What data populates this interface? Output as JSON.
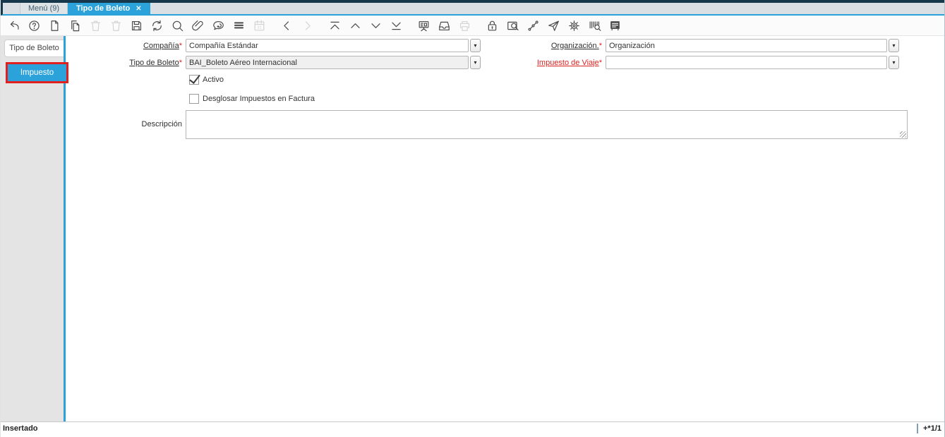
{
  "window": {
    "tabs": [
      {
        "label": "Menú (9)",
        "active": false
      },
      {
        "label": "Tipo de Boleto",
        "active": true,
        "close_glyph": "✕"
      }
    ]
  },
  "toolbar": {
    "items": [
      {
        "name": "undo",
        "icon": "undo",
        "disabled": false,
        "gap": false
      },
      {
        "name": "help",
        "icon": "help",
        "disabled": false,
        "gap": false
      },
      {
        "name": "new-record",
        "icon": "new",
        "disabled": false,
        "gap": false
      },
      {
        "name": "copy-record",
        "icon": "copy",
        "disabled": false,
        "gap": false
      },
      {
        "name": "delete-record",
        "icon": "trash",
        "disabled": true,
        "gap": false
      },
      {
        "name": "delete-selection",
        "icon": "trash",
        "disabled": true,
        "gap": false
      },
      {
        "name": "save-record",
        "icon": "save",
        "disabled": false,
        "gap": false
      },
      {
        "name": "requery",
        "icon": "refresh",
        "disabled": false,
        "gap": false
      },
      {
        "name": "find-record",
        "icon": "find",
        "disabled": false,
        "gap": false
      },
      {
        "name": "attachment",
        "icon": "attach",
        "disabled": false,
        "gap": false
      },
      {
        "name": "chat",
        "icon": "chat",
        "disabled": false,
        "gap": false
      },
      {
        "name": "grid-toggle",
        "icon": "lines",
        "disabled": false,
        "gap": false
      },
      {
        "name": "history",
        "icon": "calendar",
        "disabled": true,
        "gap": false
      },
      {
        "name": "parent-record",
        "icon": "chevL",
        "disabled": false,
        "gap": true
      },
      {
        "name": "detail-record",
        "icon": "chevR",
        "disabled": true,
        "gap": false
      },
      {
        "name": "first-record",
        "icon": "first",
        "disabled": false,
        "gap": true
      },
      {
        "name": "previous-record",
        "icon": "prev",
        "disabled": false,
        "gap": false
      },
      {
        "name": "next-record",
        "icon": "next",
        "disabled": false,
        "gap": false
      },
      {
        "name": "last-record",
        "icon": "last",
        "disabled": false,
        "gap": false
      },
      {
        "name": "report",
        "icon": "report",
        "disabled": false,
        "gap": true
      },
      {
        "name": "archive",
        "icon": "archive",
        "disabled": false,
        "gap": false
      },
      {
        "name": "print",
        "icon": "print",
        "disabled": true,
        "gap": false
      },
      {
        "name": "lock-record",
        "icon": "lock",
        "disabled": false,
        "gap": true
      },
      {
        "name": "zoom-across",
        "icon": "zoomx",
        "disabled": false,
        "gap": false
      },
      {
        "name": "workflow",
        "icon": "wf",
        "disabled": false,
        "gap": false
      },
      {
        "name": "run-process",
        "icon": "plane",
        "disabled": false,
        "gap": false
      },
      {
        "name": "preferences",
        "icon": "gear",
        "disabled": false,
        "gap": false
      },
      {
        "name": "product-info",
        "icon": "barcode",
        "disabled": false,
        "gap": false
      },
      {
        "name": "window-help",
        "icon": "notice",
        "disabled": false,
        "gap": false
      }
    ]
  },
  "sidebar": {
    "tabs": [
      {
        "label": "Tipo de Boleto",
        "active": true,
        "highlighted": false
      },
      {
        "label": "Impuesto",
        "active": false,
        "highlighted": true
      }
    ]
  },
  "form": {
    "compania": {
      "label": "Compañía",
      "required": "*",
      "value": "Compañía Estándar"
    },
    "organizacion": {
      "label": "Organización.",
      "required": "*",
      "value": "Organización"
    },
    "tipo_de_boleto": {
      "label": "Tipo de Boleto",
      "required": "*",
      "value": "BAI_Boleto Aéreo Internacional",
      "readonly": true
    },
    "impuesto_de_viaje": {
      "label": "Impuesto de Viaje",
      "required": "*",
      "value": "",
      "missing": true
    },
    "activo": {
      "label": "Activo",
      "checked": true
    },
    "desglosar": {
      "label": "Desglosar Impuestos en Factura",
      "checked": false
    },
    "descripcion": {
      "label": "Descripción",
      "value": ""
    },
    "dropdown_glyph": "▾"
  },
  "statusbar": {
    "status": "Insertado",
    "record_indicator": "+*1/1"
  },
  "colors": {
    "accent_blue": "#2ba2da",
    "highlight_red": "#e0211f",
    "topbar_dark": "#16384a",
    "mandatory_red": "#dc2320"
  }
}
